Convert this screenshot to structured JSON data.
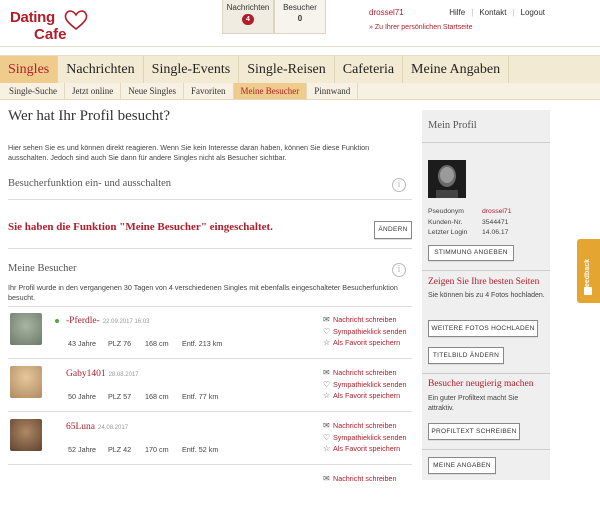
{
  "logo": {
    "line1": "Dating",
    "line2": "Cafe"
  },
  "counters": [
    {
      "label": "Nachrichten",
      "value": "4"
    },
    {
      "label": "Besucher",
      "value": "0"
    }
  ],
  "user": {
    "name": "drossel71",
    "start_link": "» Zu Ihrer persönlichen Startseite"
  },
  "toplinks": [
    "Hilfe",
    "Kontakt",
    "Logout"
  ],
  "mainnav": [
    "Singles",
    "Nachrichten",
    "Single-Events",
    "Single-Reisen",
    "Cafeteria",
    "Meine Angaben"
  ],
  "subnav": [
    "Single-Suche",
    "Jetzt online",
    "Neue Singles",
    "Favoriten",
    "Meine Besucher",
    "Pinnwand"
  ],
  "page": {
    "title": "Wer hat Ihr Profil besucht?",
    "intro": "Hier sehen Sie es und können direkt reagieren. Wenn Sie kein Interesse daran haben, können Sie diese Funktion ausschalten. Jedoch sind auch Sie dann für andere Singles nicht als Besucher sichtbar.",
    "toggle_heading": "Besucherfunktion ein- und ausschalten",
    "status_message": "Sie haben die Funktion \"Meine Besucher\" eingeschaltet.",
    "change_button": "ÄNDERN",
    "visitors_heading": "Meine Besucher",
    "visitors_desc": "Ihr Profil wurde in den vergangenen 30 Tagen von 4 verschiedenen Singles mit ebenfalls eingeschalteter Besucherfunktion besucht."
  },
  "actions": [
    "Nachricht schreiben",
    "Sympathieklick senden",
    "Als Favorit speichern"
  ],
  "visitors": [
    {
      "name": "-Pferdle-",
      "date": "22.09.2017 16:03",
      "age": "43 Jahre",
      "plz": "PLZ 76",
      "height": "168 cm",
      "distance": "Entf. 213 km",
      "online": true,
      "avatar_color": "#8a9a88"
    },
    {
      "name": "Gaby1401",
      "date": "28.08.2017",
      "age": "50 Jahre",
      "plz": "PLZ 57",
      "height": "168 cm",
      "distance": "Entf. 77 km",
      "online": false,
      "avatar_color": "#c9a27a"
    },
    {
      "name": "65Luna",
      "date": "24.08.2017",
      "age": "52 Jahre",
      "plz": "PLZ 42",
      "height": "170 cm",
      "distance": "Entf. 52 km",
      "online": false,
      "avatar_color": "#8c6a4a"
    }
  ],
  "sidebar": {
    "heading": "Mein Profil",
    "meta": [
      {
        "key": "Pseudonym",
        "value": "drossel71"
      },
      {
        "key": "Kunden-Nr.",
        "value": "3544471"
      },
      {
        "key": "Letzter Login",
        "value": "14.06.17"
      }
    ],
    "stimmung_button": "STIMMUNG ANGEBEN",
    "photos_heading": "Zeigen Sie Ihre besten Seiten",
    "photos_text": "Sie können bis zu 4 Fotos hochladen.",
    "upload_button": "WEITERE FOTOS HOCHLADEN",
    "title_button": "TITELBILD ÄNDERN",
    "curious_heading": "Besucher neugierig machen",
    "curious_text": "Ein guter Profiltext macht Sie attraktiv.",
    "profiltext_button": "PROFILTEXT SCHREIBEN",
    "angaben_button": "MEINE ANGABEN"
  },
  "feedback": "Feedback",
  "colors": {
    "brand": "#b01e2a",
    "nav_bg": "#f3ead3",
    "nav_active": "#efcb8c",
    "feedback": "#e5a531"
  }
}
